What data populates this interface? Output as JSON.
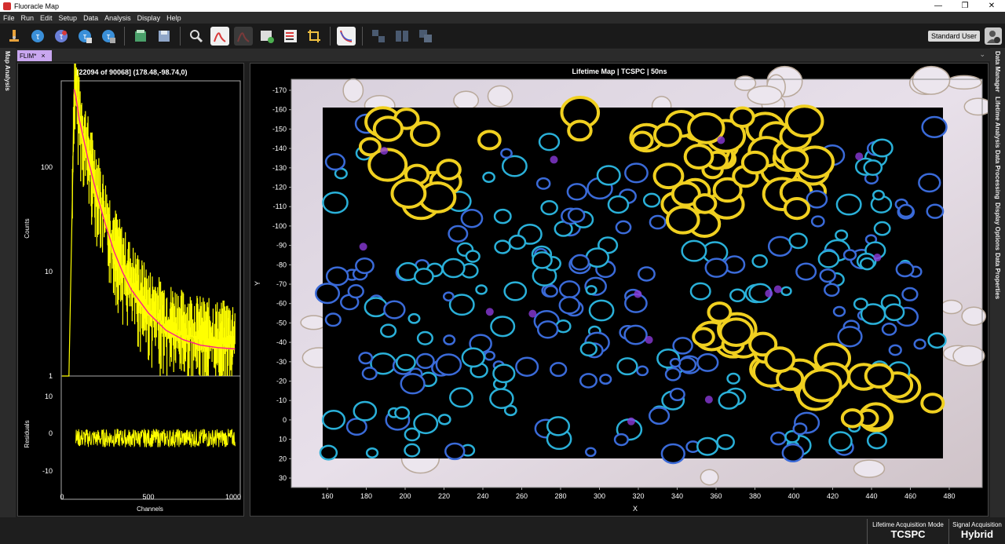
{
  "window": {
    "title": "Fluoracle Map",
    "controls": [
      "—",
      "❐",
      "✕"
    ]
  },
  "menu": [
    "File",
    "Run",
    "Edit",
    "Setup",
    "Data",
    "Analysis",
    "Display",
    "Help"
  ],
  "toolbar": {
    "buttons": [
      "microscope-icon",
      "tau-icon",
      "tau-red-icon",
      "tau-multi-icon",
      "tau-fit-icon",
      "open-file-icon",
      "save-icon",
      "zoom-icon",
      "spectrum-icon",
      "spectrum-disabled-icon",
      "table-check-icon",
      "checklist-icon",
      "crop-icon",
      "decay-icon",
      "layout-a-icon",
      "layout-b-icon",
      "layout-c-icon"
    ]
  },
  "user": {
    "label": "Standard User",
    "icon": "user-settings-icon"
  },
  "left_rail": {
    "tabs": [
      "Map Analysis"
    ]
  },
  "right_rail": {
    "tabs": [
      "Data Manager",
      "Lifetime Analysis",
      "Data Processing",
      "Display Options",
      "Data Properties"
    ]
  },
  "doc_tab": {
    "label": "FLIM*",
    "close": "×"
  },
  "decay_plot": {
    "header": "[22094 of 90068] (178.48,-98.74,0)",
    "ylabel": "Counts",
    "xlabel": "Channels",
    "residual_label": "Residuals",
    "y_ticks": [
      "100",
      "10",
      "1"
    ],
    "residual_ticks": [
      "10",
      "0",
      "-10"
    ],
    "x_ticks": [
      "0",
      "500",
      "1000"
    ]
  },
  "map": {
    "title": "Lifetime Map | TCSPC | 50ns",
    "xlabel": "X",
    "ylabel": "Y",
    "x_ticks": [
      "160",
      "180",
      "200",
      "220",
      "240",
      "260",
      "280",
      "300",
      "320",
      "340",
      "360",
      "380",
      "400",
      "420",
      "440",
      "460",
      "480"
    ],
    "y_ticks": [
      "-170",
      "-160",
      "-150",
      "-140",
      "-130",
      "-120",
      "-110",
      "-100",
      "-90",
      "-80",
      "-70",
      "-60",
      "-50",
      "-40",
      "-30",
      "-20",
      "-10",
      "0",
      "10",
      "20",
      "30"
    ]
  },
  "status": {
    "mode_label": "Lifetime Acquisition Mode",
    "mode_value": "TCSPC",
    "signal_label": "Signal Acquisition",
    "signal_value": "Hybrid"
  },
  "chart_data": {
    "type": "line",
    "title": "[22094 of 90068] (178.48,-98.74,0)",
    "xlabel": "Channels",
    "ylabel": "Counts",
    "yscale": "log",
    "xlim": [
      0,
      1030
    ],
    "ylim": [
      1,
      600
    ],
    "series": [
      {
        "kind": "data",
        "color": "#ffff00",
        "x": [
          0,
          40,
          60,
          70,
          80,
          100,
          150,
          200,
          250,
          300,
          350,
          400,
          500,
          600,
          700,
          800,
          900,
          1000
        ],
        "y": [
          1,
          1,
          50,
          500,
          430,
          250,
          110,
          55,
          28,
          16,
          10,
          7,
          4,
          3,
          2.5,
          2.2,
          2,
          2
        ]
      },
      {
        "kind": "fit",
        "color": "#ff1a8c",
        "x": [
          70,
          80,
          100,
          150,
          200,
          250,
          300,
          350,
          400,
          500,
          600,
          700,
          800,
          900,
          1000
        ],
        "y": [
          500,
          430,
          260,
          110,
          52,
          27,
          15,
          9.5,
          6.5,
          3.9,
          2.7,
          2.2,
          1.95,
          1.85,
          1.8
        ]
      }
    ],
    "residuals": {
      "color": "#ffff00",
      "xlim": [
        80,
        1000
      ],
      "ylim": [
        -13,
        13
      ],
      "ticks": [
        -10,
        0,
        10
      ]
    }
  }
}
